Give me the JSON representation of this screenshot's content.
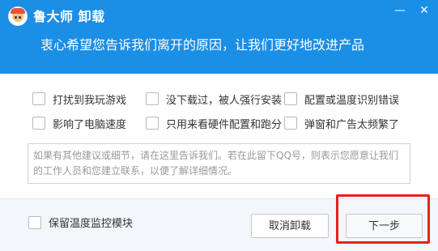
{
  "window": {
    "title": "鲁大师 卸载",
    "minimize_label": "—",
    "close_label": "✕"
  },
  "header": {
    "subtitle": "衷心希望您告诉我们离开的原因，让我们更好地改进产品"
  },
  "reasons": [
    {
      "label": "打扰到我玩游戏",
      "checked": false
    },
    {
      "label": "没下载过，被人强行安装",
      "checked": false
    },
    {
      "label": "配置或温度识别错误",
      "checked": false
    },
    {
      "label": "影响了电脑速度",
      "checked": false
    },
    {
      "label": "只用来看硬件配置和跑分",
      "checked": false
    },
    {
      "label": "弹窗和广告太频繁了",
      "checked": false
    }
  ],
  "feedback": {
    "placeholder_line1": "如果有其他建议或细节，请在这里告诉我们。若在此留下QQ号，则表示您愿意让我们",
    "placeholder_line2": "的工作人员和您建立联系，以便了解详细情况。",
    "value": ""
  },
  "footer": {
    "keep_monitor_label": "保留温度监控模块",
    "keep_monitor_checked": false,
    "cancel_label": "取消卸载",
    "next_label": "下一步"
  },
  "colors": {
    "header_bg": "#1b8ee6",
    "highlight": "#e8201c"
  },
  "icons": {
    "app_logo": "ludashi-logo-icon",
    "minimize": "minimize-icon",
    "close": "close-icon"
  }
}
